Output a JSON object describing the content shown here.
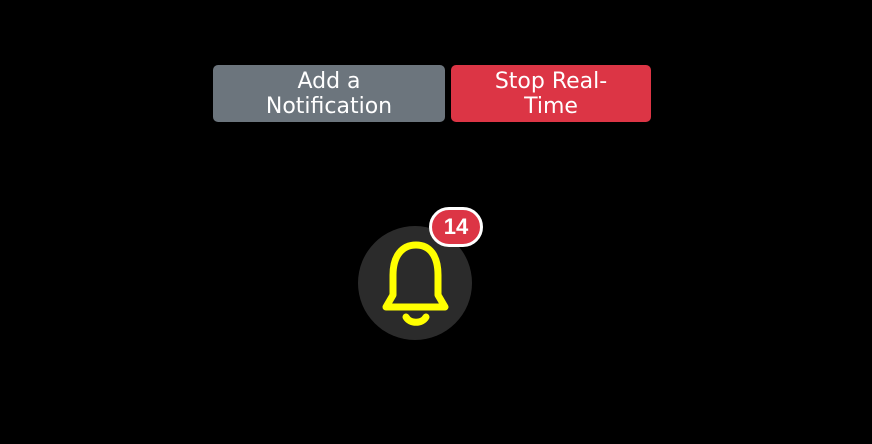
{
  "toolbar": {
    "add_notification_label": "Add a Notification",
    "stop_realtime_label": "Stop Real-Time"
  },
  "notifications": {
    "icon": "bell-icon",
    "count": "14"
  },
  "colors": {
    "background": "#000000",
    "secondary_button": "#6c757d",
    "danger_button": "#dc3545",
    "bell_circle": "#2b2b2b",
    "bell": "#ffff00",
    "badge": "#dc3545",
    "badge_border": "#ffffff"
  }
}
